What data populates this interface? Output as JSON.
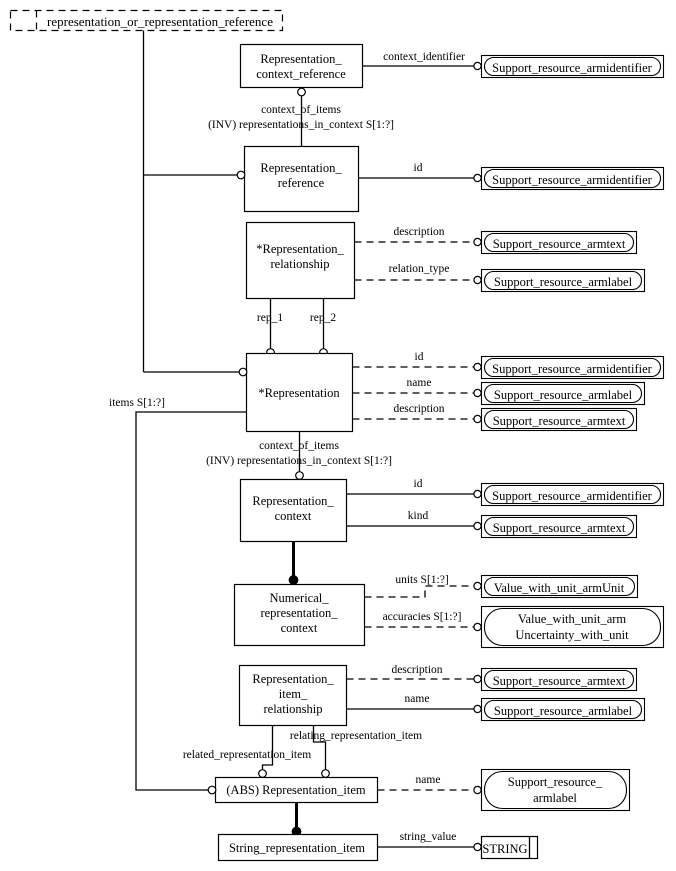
{
  "schema": {
    "label": "representation_or_representation_reference"
  },
  "entities": [
    {
      "id": "representation_context_reference",
      "lines": [
        "Representation_",
        "context_reference"
      ]
    },
    {
      "id": "representation_reference",
      "lines": [
        "Representation_",
        "reference"
      ]
    },
    {
      "id": "representation_relationship",
      "lines": [
        "*Representation_",
        "relationship"
      ]
    },
    {
      "id": "representation",
      "lines": [
        "*Representation"
      ]
    },
    {
      "id": "representation_context",
      "lines": [
        "Representation_",
        "context"
      ]
    },
    {
      "id": "numerical_representation_context",
      "lines": [
        "Numerical_",
        "representation_",
        "context"
      ]
    },
    {
      "id": "representation_item_relationship",
      "lines": [
        "Representation_",
        "item_",
        "relationship"
      ]
    },
    {
      "id": "representation_item",
      "lines": [
        "(ABS) Representation_item"
      ]
    },
    {
      "id": "string_representation_item",
      "lines": [
        "String_representation_item"
      ]
    }
  ],
  "types": [
    {
      "id": "t1",
      "lines": [
        "Support_resource_armidentifier"
      ]
    },
    {
      "id": "t2",
      "lines": [
        "Support_resource_armidentifier"
      ]
    },
    {
      "id": "t3",
      "lines": [
        "Support_resource_armtext"
      ]
    },
    {
      "id": "t4",
      "lines": [
        "Support_resource_armlabel"
      ]
    },
    {
      "id": "t5",
      "lines": [
        "Support_resource_armidentifier"
      ]
    },
    {
      "id": "t6",
      "lines": [
        "Support_resource_armlabel"
      ]
    },
    {
      "id": "t7",
      "lines": [
        "Support_resource_armtext"
      ]
    },
    {
      "id": "t8",
      "lines": [
        "Support_resource_armidentifier"
      ]
    },
    {
      "id": "t9",
      "lines": [
        "Support_resource_armtext"
      ]
    },
    {
      "id": "t10",
      "lines": [
        "Value_with_unit_armUnit"
      ]
    },
    {
      "id": "t11",
      "lines": [
        "Value_with_unit_arm",
        "Uncertainty_with_unit"
      ]
    },
    {
      "id": "t12",
      "lines": [
        "Support_resource_armtext"
      ]
    },
    {
      "id": "t13",
      "lines": [
        "Support_resource_armlabel"
      ]
    },
    {
      "id": "t14",
      "lines": [
        "Support_resource_",
        "armlabel"
      ]
    },
    {
      "id": "t15",
      "lines": [
        "STRING"
      ]
    }
  ],
  "attribute_labels": [
    {
      "id": "a_context_identifier",
      "text": "context_identifier"
    },
    {
      "id": "a_context_of_items_1",
      "text": "context_of_items"
    },
    {
      "id": "a_inv_reps_in_context_1",
      "text": "(INV) representations_in_context S[1:?]"
    },
    {
      "id": "a_id_1",
      "text": "id"
    },
    {
      "id": "a_description_1",
      "text": "description"
    },
    {
      "id": "a_relation_type",
      "text": "relation_type"
    },
    {
      "id": "a_rep_1",
      "text": "rep_1"
    },
    {
      "id": "a_rep_2",
      "text": "rep_2"
    },
    {
      "id": "a_id_2",
      "text": "id"
    },
    {
      "id": "a_name_1",
      "text": "name"
    },
    {
      "id": "a_description_2",
      "text": "description"
    },
    {
      "id": "a_items",
      "text": "items S[1:?]"
    },
    {
      "id": "a_context_of_items_2",
      "text": "context_of_items"
    },
    {
      "id": "a_inv_reps_in_context_2",
      "text": "(INV) representations_in_context S[1:?]"
    },
    {
      "id": "a_id_3",
      "text": "id"
    },
    {
      "id": "a_kind",
      "text": "kind"
    },
    {
      "id": "a_units",
      "text": "units S[1:?]"
    },
    {
      "id": "a_accuracies",
      "text": "accuracies S[1:?]"
    },
    {
      "id": "a_description_3",
      "text": "description"
    },
    {
      "id": "a_name_2",
      "text": "name"
    },
    {
      "id": "a_relating_representation_item",
      "text": "relating_representation_item"
    },
    {
      "id": "a_related_representation_item",
      "text": "related_representation_item"
    },
    {
      "id": "a_name_3",
      "text": "name"
    },
    {
      "id": "a_string_value",
      "text": "string_value"
    }
  ]
}
